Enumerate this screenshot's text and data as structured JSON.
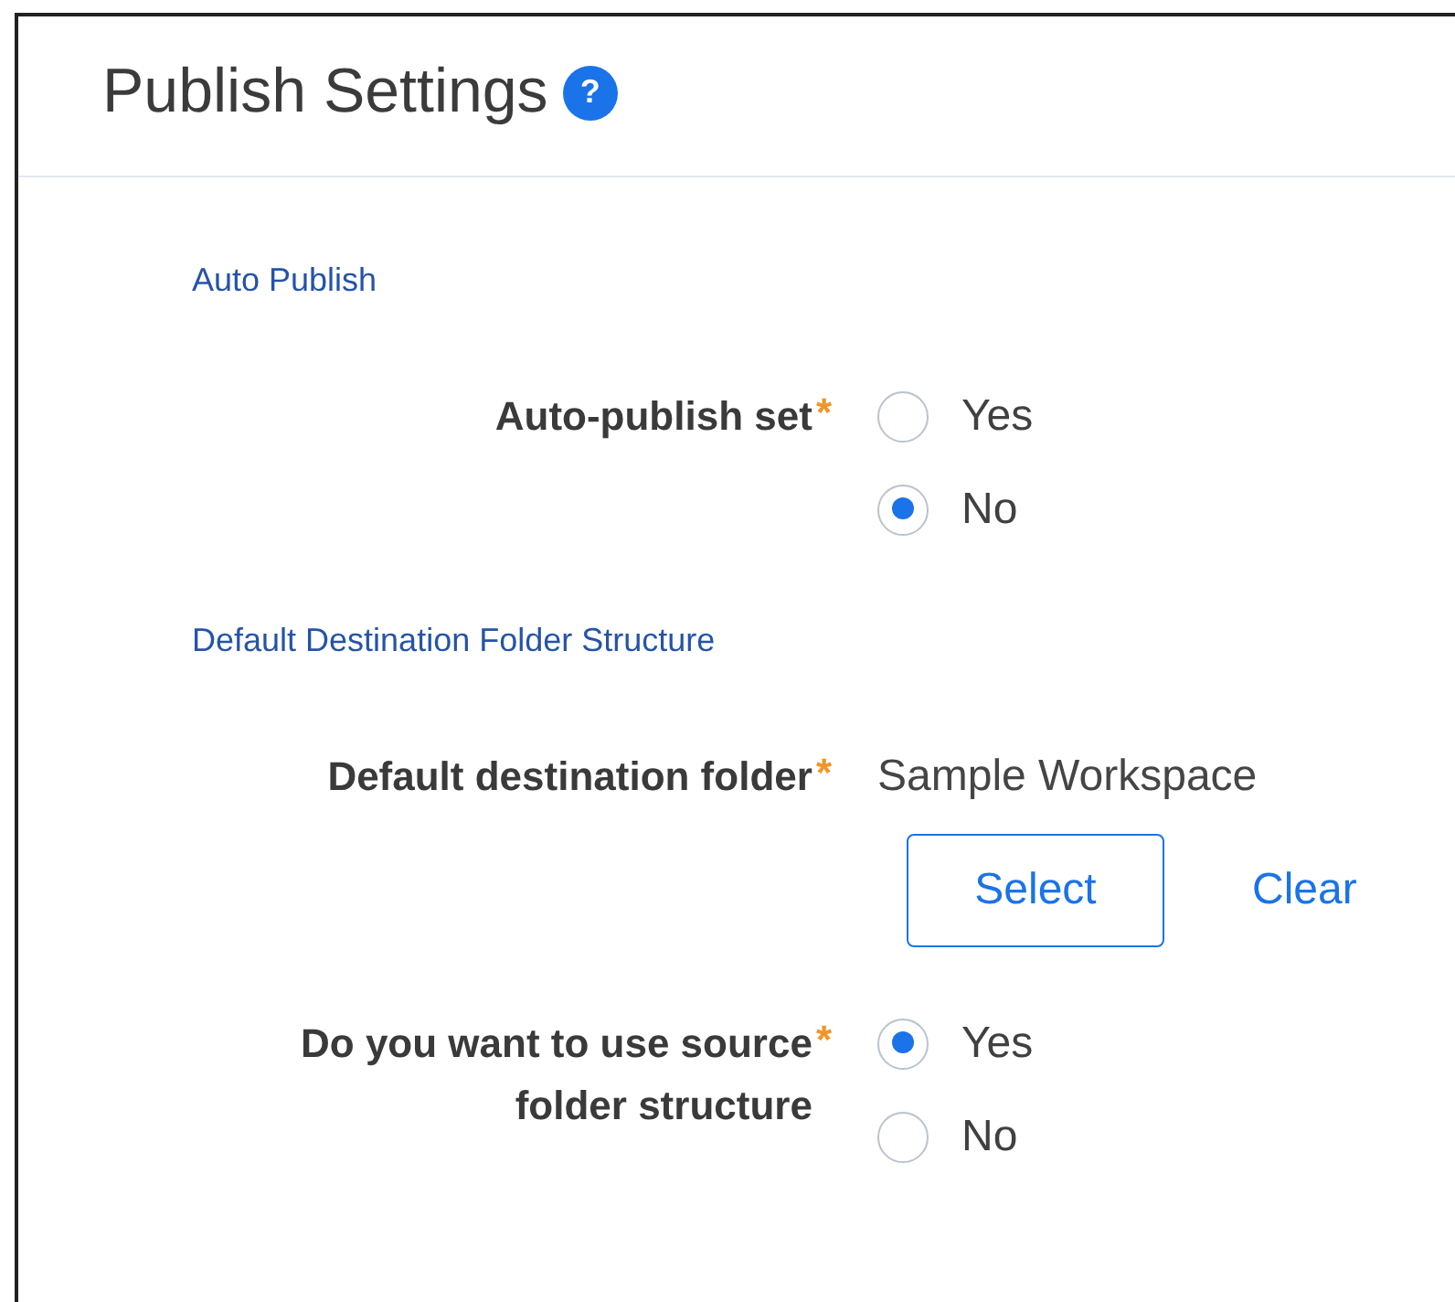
{
  "header": {
    "title": "Publish Settings",
    "help_icon": "?"
  },
  "sections": [
    {
      "heading": "Auto Publish",
      "fields": [
        {
          "kind": "radio",
          "label": "Auto-publish set",
          "required_mark": "*",
          "options": [
            {
              "label": "Yes",
              "selected": false
            },
            {
              "label": "No",
              "selected": true
            }
          ]
        }
      ]
    },
    {
      "heading": "Default Destination Folder Structure",
      "fields": [
        {
          "kind": "folder",
          "label": "Default destination folder",
          "required_mark": "*",
          "value": "Sample Workspace",
          "buttons": [
            "Select",
            "Clear"
          ]
        },
        {
          "kind": "radio",
          "label": "Do you want to use source folder structure",
          "required_mark": "*",
          "options": [
            {
              "label": "Yes",
              "selected": true
            },
            {
              "label": "No",
              "selected": false
            }
          ]
        }
      ]
    }
  ]
}
